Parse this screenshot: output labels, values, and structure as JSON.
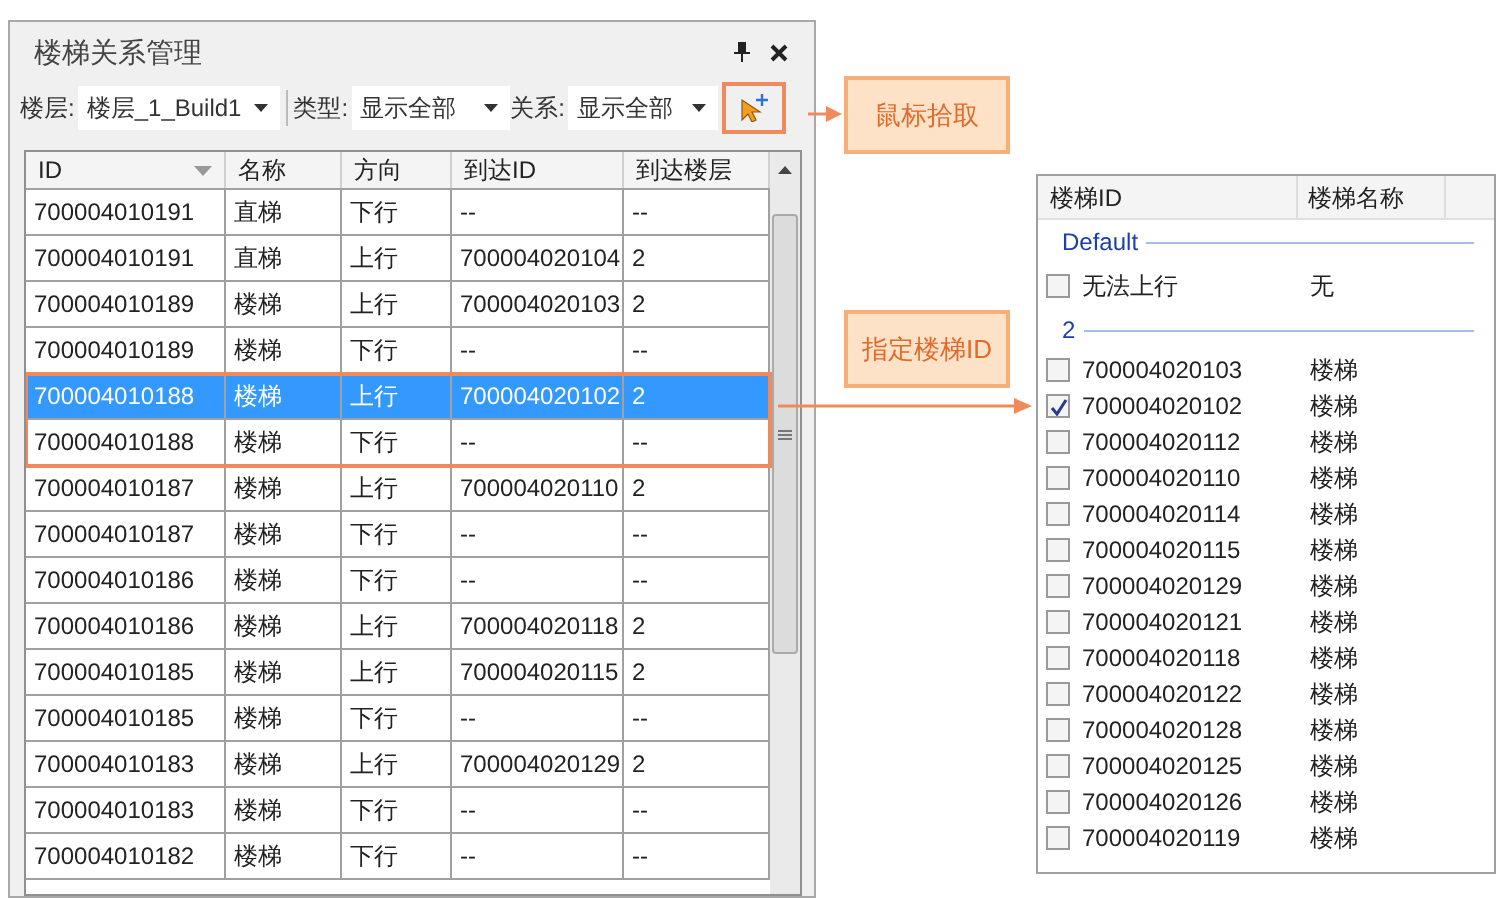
{
  "panel": {
    "title": "楼梯关系管理",
    "toolbar": {
      "floor_label": "楼层:",
      "floor_value": "楼层_1_Build1",
      "type_label": "类型:",
      "type_value": "显示全部",
      "relation_label": "关系:",
      "relation_value": "显示全部",
      "pick_button_framed": true
    },
    "table": {
      "columns": [
        "ID",
        "名称",
        "方向",
        "到达ID",
        "到达楼层"
      ],
      "rows": [
        {
          "cells": [
            "700004010191",
            "直梯",
            "下行",
            "--",
            "--"
          ],
          "selected": false,
          "framed": false
        },
        {
          "cells": [
            "700004010191",
            "直梯",
            "上行",
            "700004020104",
            "2"
          ],
          "selected": false,
          "framed": false
        },
        {
          "cells": [
            "700004010189",
            "楼梯",
            "上行",
            "700004020103",
            "2"
          ],
          "selected": false,
          "framed": false
        },
        {
          "cells": [
            "700004010189",
            "楼梯",
            "下行",
            "--",
            "--"
          ],
          "selected": false,
          "framed": false
        },
        {
          "cells": [
            "700004010188",
            "楼梯",
            "上行",
            "700004020102",
            "2"
          ],
          "selected": true,
          "framed": true
        },
        {
          "cells": [
            "700004010188",
            "楼梯",
            "下行",
            "--",
            "--"
          ],
          "selected": false,
          "framed": true
        },
        {
          "cells": [
            "700004010187",
            "楼梯",
            "上行",
            "700004020110",
            "2"
          ],
          "selected": false,
          "framed": false
        },
        {
          "cells": [
            "700004010187",
            "楼梯",
            "下行",
            "--",
            "--"
          ],
          "selected": false,
          "framed": false
        },
        {
          "cells": [
            "700004010186",
            "楼梯",
            "下行",
            "--",
            "--"
          ],
          "selected": false,
          "framed": false
        },
        {
          "cells": [
            "700004010186",
            "楼梯",
            "上行",
            "700004020118",
            "2"
          ],
          "selected": false,
          "framed": false
        },
        {
          "cells": [
            "700004010185",
            "楼梯",
            "上行",
            "700004020115",
            "2"
          ],
          "selected": false,
          "framed": false
        },
        {
          "cells": [
            "700004010185",
            "楼梯",
            "下行",
            "--",
            "--"
          ],
          "selected": false,
          "framed": false
        },
        {
          "cells": [
            "700004010183",
            "楼梯",
            "上行",
            "700004020129",
            "2"
          ],
          "selected": false,
          "framed": false
        },
        {
          "cells": [
            "700004010183",
            "楼梯",
            "下行",
            "--",
            "--"
          ],
          "selected": false,
          "framed": false
        },
        {
          "cells": [
            "700004010182",
            "楼梯",
            "下行",
            "--",
            "--"
          ],
          "selected": false,
          "framed": false
        }
      ]
    }
  },
  "callouts": [
    {
      "text": "鼠标拾取"
    },
    {
      "text": "指定楼梯ID"
    }
  ],
  "stair_list": {
    "columns": [
      "楼梯ID",
      "楼梯名称"
    ],
    "groups": [
      {
        "name": "Default",
        "items": [
          {
            "id": "无法上行",
            "name": "无",
            "checked": false
          }
        ]
      },
      {
        "name": "2",
        "items": [
          {
            "id": "700004020103",
            "name": "楼梯",
            "checked": false
          },
          {
            "id": "700004020102",
            "name": "楼梯",
            "checked": true
          },
          {
            "id": "700004020112",
            "name": "楼梯",
            "checked": false
          },
          {
            "id": "700004020110",
            "name": "楼梯",
            "checked": false
          },
          {
            "id": "700004020114",
            "name": "楼梯",
            "checked": false
          },
          {
            "id": "700004020115",
            "name": "楼梯",
            "checked": false
          },
          {
            "id": "700004020129",
            "name": "楼梯",
            "checked": false
          },
          {
            "id": "700004020121",
            "name": "楼梯",
            "checked": false
          },
          {
            "id": "700004020118",
            "name": "楼梯",
            "checked": false
          },
          {
            "id": "700004020122",
            "name": "楼梯",
            "checked": false
          },
          {
            "id": "700004020128",
            "name": "楼梯",
            "checked": false
          },
          {
            "id": "700004020125",
            "name": "楼梯",
            "checked": false
          },
          {
            "id": "700004020126",
            "name": "楼梯",
            "checked": false
          },
          {
            "id": "700004020119",
            "name": "楼梯",
            "checked": false
          }
        ]
      }
    ]
  }
}
